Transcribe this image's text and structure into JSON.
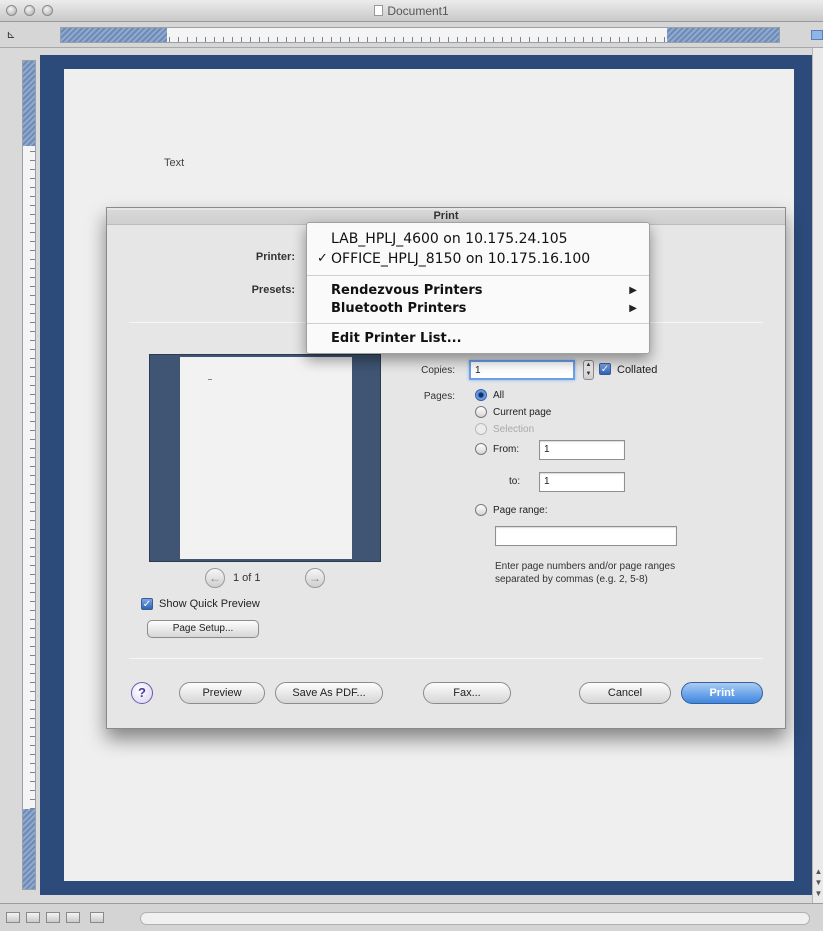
{
  "window": {
    "title": "Document1"
  },
  "document": {
    "body_text": "Text"
  },
  "print_dialog": {
    "title": "Print",
    "printer_label": "Printer:",
    "presets_label": "Presets:",
    "copies_label": "Copies:",
    "copies_value": "1",
    "collated_label": "Collated",
    "collated_checked": true,
    "pages_label": "Pages:",
    "page_options": [
      {
        "label": "All",
        "selected": true,
        "enabled": true
      },
      {
        "label": "Current page",
        "selected": false,
        "enabled": true
      },
      {
        "label": "Selection",
        "selected": false,
        "enabled": false
      },
      {
        "label": "From:",
        "selected": false,
        "enabled": true
      },
      {
        "label": "Page range:",
        "selected": false,
        "enabled": true
      }
    ],
    "from_value": "1",
    "to_label": "to:",
    "to_value": "1",
    "page_range_value": "",
    "page_range_hint": "Enter page numbers and/or page ranges separated by commas (e.g. 2, 5-8)",
    "preview_counter": "1 of 1",
    "show_quick_preview_label": "Show Quick Preview",
    "show_quick_preview_checked": true,
    "page_setup_label": "Page Setup...",
    "buttons": {
      "help": "?",
      "preview": "Preview",
      "save_as_pdf": "Save As PDF...",
      "fax": "Fax...",
      "cancel": "Cancel",
      "print": "Print"
    }
  },
  "printer_menu": {
    "items": [
      {
        "label": "LAB_HPLJ_4600 on 10.175.24.105",
        "checked": false
      },
      {
        "label": "OFFICE_HPLJ_8150 on 10.175.16.100",
        "checked": true
      }
    ],
    "submenus": [
      {
        "label": "Rendezvous Printers"
      },
      {
        "label": "Bluetooth Printers"
      }
    ],
    "edit_item": "Edit Printer List...",
    "check_glyph": "✓",
    "arrow_glyph": "▶"
  },
  "colors": {
    "document_background": "#2c4b7a",
    "accent_blue": "#3f86e0"
  }
}
